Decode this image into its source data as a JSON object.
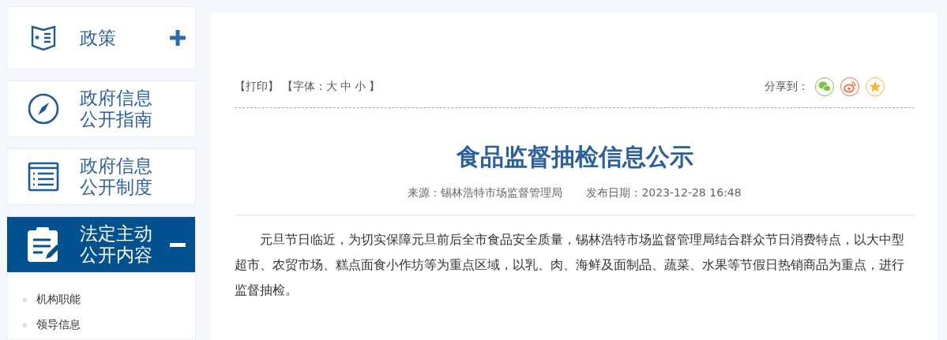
{
  "sidebar": {
    "items": [
      {
        "label": "政策",
        "kind": "book",
        "expandable": true,
        "expanded": false
      },
      {
        "label": "政府信息公开指南",
        "kind": "compass",
        "expandable": false,
        "expanded": false
      },
      {
        "label": "政府信息公开制度",
        "kind": "list",
        "expandable": false,
        "expanded": false
      },
      {
        "label": "法定主动公开内容",
        "kind": "clipboard",
        "expandable": true,
        "expanded": true,
        "children": [
          {
            "label": "机构职能"
          },
          {
            "label": "领导信息"
          }
        ]
      }
    ]
  },
  "toolbar": {
    "print": "【打印】",
    "font_label": "【字体：",
    "font_sizes": [
      "大",
      "中",
      "小"
    ],
    "font_end": "】",
    "share_label": "分享到：",
    "share": [
      {
        "kind": "wechat",
        "color": "#7cc243"
      },
      {
        "kind": "weibo",
        "color": "#f0713f"
      },
      {
        "kind": "qzone",
        "color": "#f7b731"
      }
    ]
  },
  "article": {
    "title": "食品监督抽检信息公示",
    "source": "来源：锡林浩特市场监督管理局",
    "date": "发布日期：2023-12-28 16:48",
    "paragraphs": [
      "元旦节日临近，为切实保障元旦前后全市食品安全质量，锡林浩特市场监督管理局结合群众节日消费特点，以大中型超市、农贸市场、糕点面食小作坊等为重点区域，以乳、肉、海鲜及面制品、蔬菜、水果等节假日热销商品为重点，进行监督抽检。"
    ]
  }
}
